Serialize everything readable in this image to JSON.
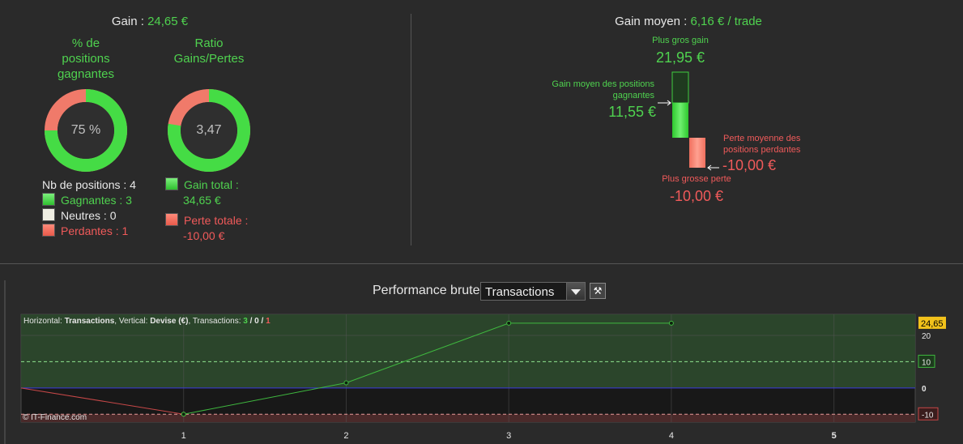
{
  "summary": {
    "gain_label": "Gain : ",
    "gain_value": "24,65 €",
    "win_title_1": "% de",
    "win_title_2": "positions",
    "win_title_3": "gagnantes",
    "win_percent": "75 %",
    "win_fraction": 0.75,
    "ratio_title_1": "Ratio",
    "ratio_title_2": "Gains/Pertes",
    "ratio_value": "3,47",
    "ratio_fraction": 0.776,
    "positions_label": "Nb de positions : 4",
    "winning": "Gagnantes : 3",
    "neutral": "Neutres : 0",
    "losing": "Perdantes : 1",
    "total_gain_1": "Gain total :",
    "total_gain_2": "34,65 €",
    "total_loss_1": "Perte totale :",
    "total_loss_2": "-10,00 €"
  },
  "average": {
    "title_label": "Gain moyen : ",
    "title_value": "6,16 € / trade",
    "max_gain_label": "Plus gros gain",
    "max_gain_value": "21,95 €",
    "avg_win_label_1": "Gain moyen des positions",
    "avg_win_label_2": "gagnantes",
    "avg_win_value": "11,55 €",
    "avg_loss_label_1": "Perte moyenne des",
    "avg_loss_label_2": "positions perdantes",
    "avg_loss_value": "-10,00 €",
    "max_loss_label": "Plus grosse perte",
    "max_loss_value": "-10,00 €"
  },
  "performance": {
    "label": "Performance brute",
    "selected": "Transactions",
    "wrench_icon": "wrench-icon"
  },
  "colors": {
    "green": "#4fd24f",
    "red": "#f05a5a",
    "yellow": "#f2c21b",
    "blue": "#3b3bdc"
  },
  "chart_data": {
    "type": "line",
    "info_prefix": "Horizontal: ",
    "info_h": "Transactions",
    "info_mid": ", Vertical: ",
    "info_v": "Devise (€)",
    "info_tx": ", Transactions: ",
    "info_win": "3",
    "info_sep": " / ",
    "info_neutral": "0",
    "info_loss": "1",
    "copyright": "© IT-Finance.com",
    "xlim": [
      0,
      5.5
    ],
    "ylim": [
      -13,
      28
    ],
    "x_ticks": [
      "1",
      "2",
      "3",
      "4",
      "5"
    ],
    "y_ticks": [
      {
        "value": 20,
        "label": "20",
        "style": "plain"
      },
      {
        "value": 10,
        "label": "10",
        "style": "green"
      },
      {
        "value": 0,
        "label": "0",
        "style": "bold"
      },
      {
        "value": -10,
        "label": "-10",
        "style": "red"
      }
    ],
    "current_value": 24.65,
    "current_label": "24,65",
    "reference_lines": [
      {
        "value": 10,
        "color": "green",
        "dashed": true
      },
      {
        "value": 0,
        "color": "blue",
        "dashed": false
      },
      {
        "value": -10,
        "color": "red",
        "dashed": true
      }
    ],
    "series": [
      {
        "color": "red",
        "x": [
          0,
          1
        ],
        "y": [
          0,
          -10
        ]
      },
      {
        "color": "green",
        "x": [
          1,
          2,
          3,
          4
        ],
        "y": [
          -10,
          1.95,
          24.65,
          24.65
        ]
      }
    ]
  }
}
